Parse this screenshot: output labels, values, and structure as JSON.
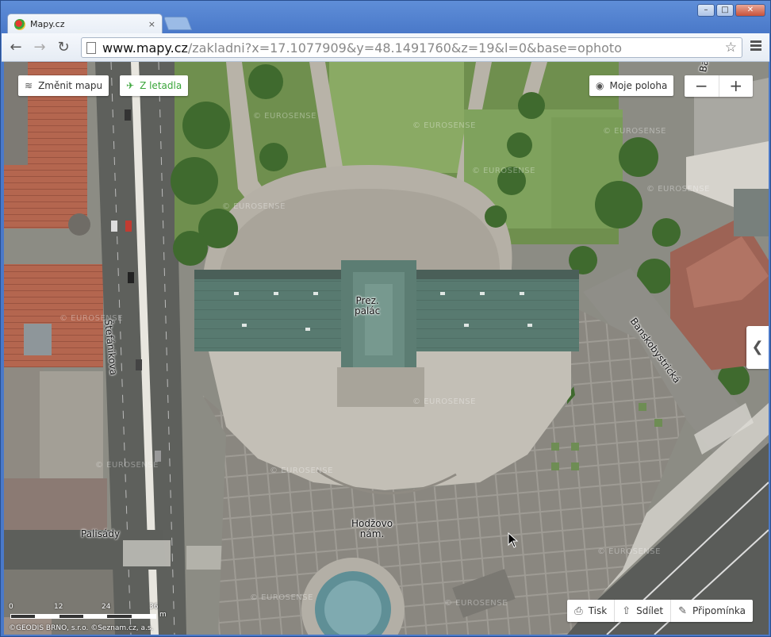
{
  "browser": {
    "tab_title": "Mapy.cz",
    "tab_close": "×",
    "url_host": "www.mapy.cz",
    "url_path": "/zakladni?x=17.1077909&y=48.1491760&z=19&l=0&base=ophoto",
    "window_controls": {
      "minimize": "–",
      "maximize": "□",
      "close": "✕"
    }
  },
  "map": {
    "controls": {
      "change_map": "Změnit mapu",
      "aerial": "Z letadla",
      "my_location": "Moje poloha",
      "zoom_out": "−",
      "zoom_in": "+",
      "side_panel": "❮"
    },
    "bottom_actions": {
      "print": "Tisk",
      "share": "Sdílet",
      "feedback": "Připomínka"
    },
    "labels": {
      "palace": "Prez.\npalác",
      "square": "Hodžovo\nnám.",
      "street_stefanikova": "Štefánikova",
      "street_palisady": "Palisády",
      "street_banskobystricka": "Banskobystrická",
      "corner_top": "Ba"
    },
    "watermark": "© EUROSENSE",
    "scale": {
      "ticks": [
        "0",
        "12",
        "24",
        "36"
      ],
      "unit": "m"
    },
    "copyright": "©GEODIS BRNO, s.r.o. ©Seznam.cz, a.s."
  },
  "colors": {
    "green_accent": "#3aa53a",
    "roof": "#5b7a70",
    "grass": "#7ea35a",
    "plaza": "#b9b5ad"
  }
}
